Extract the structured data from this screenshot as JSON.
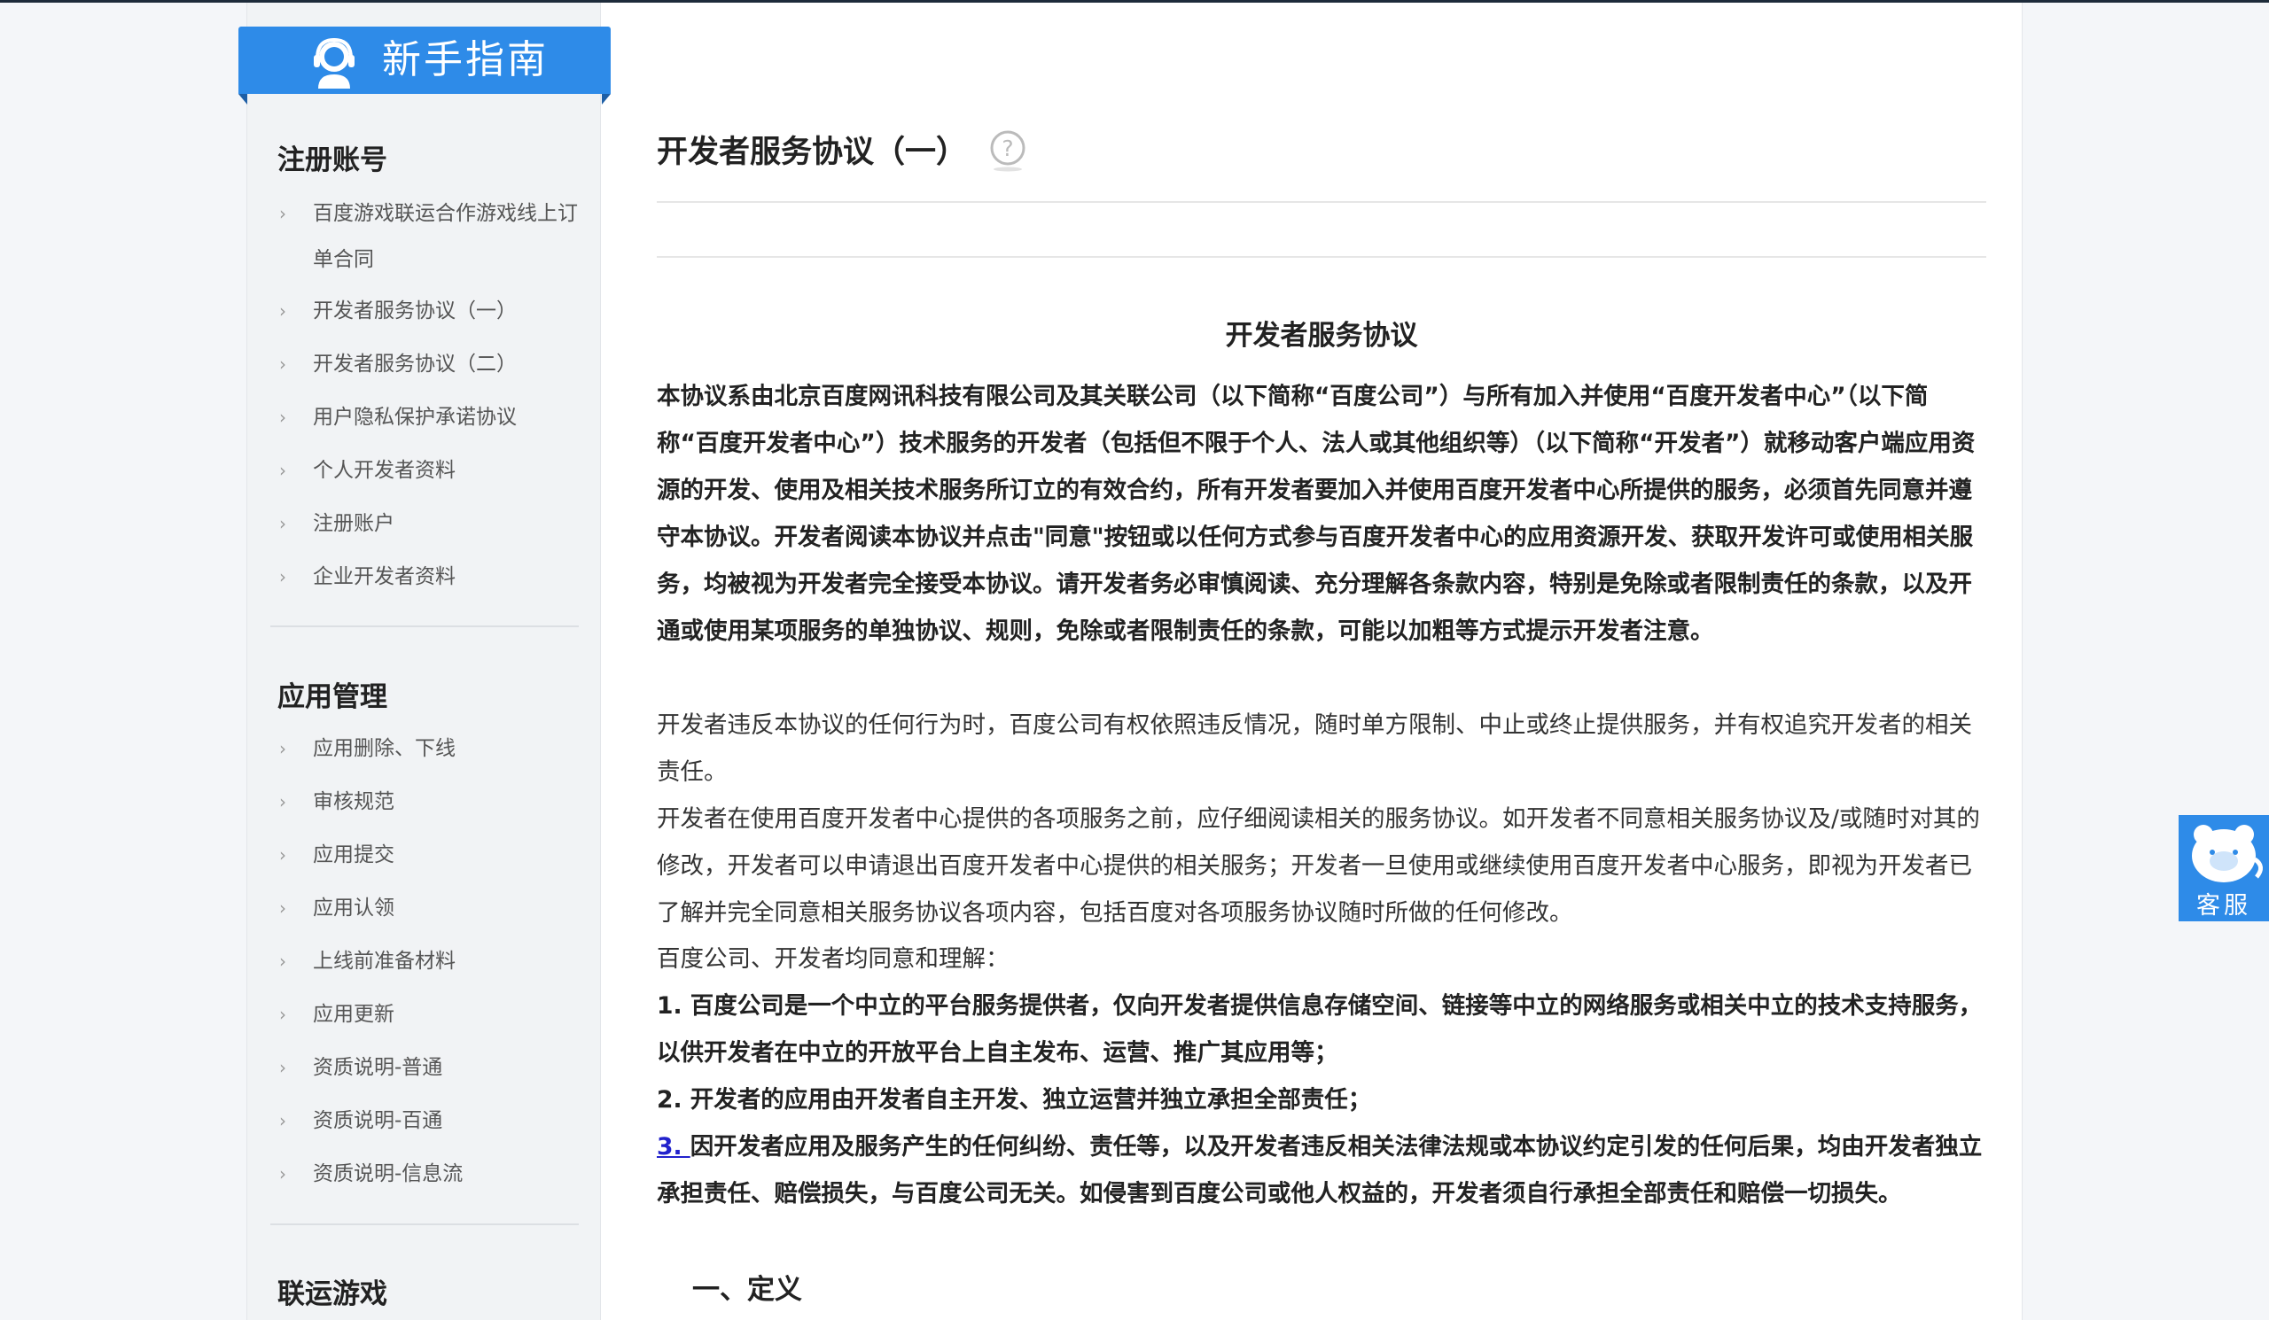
{
  "sidebar": {
    "banner_title": "新手指南",
    "sections": [
      {
        "heading": "注册账号",
        "items": [
          "百度游戏联运合作游戏线上订单合同",
          "开发者服务协议（一）",
          "开发者服务协议（二）",
          "用户隐私保护承诺协议",
          "个人开发者资料",
          "注册账户",
          "企业开发者资料"
        ]
      },
      {
        "heading": "应用管理",
        "items": [
          "应用删除、下线",
          "审核规范",
          "应用提交",
          "应用认领",
          "上线前准备材料",
          "应用更新",
          "资质说明-普通",
          "资质说明-百通",
          "资质说明-信息流"
        ]
      },
      {
        "heading": "联运游戏",
        "items": []
      }
    ]
  },
  "main": {
    "title": "开发者服务协议（一）",
    "doc_title": "开发者服务协议",
    "paragraphs": {
      "p1": "本协议系由北京百度网讯科技有限公司及其关联公司（以下简称“百度公司”）与所有加入并使用“百度开发者中心”（以下简称“百度开发者中心”）技术服务的开发者（包括但不限于个人、法人或其他组织等）（以下简称“开发者”）就移动客户端应用资源的开发、使用及相关技术服务所订立的有效合约，所有开发者要加入并使用百度开发者中心所提供的服务，必须首先同意并遵守本协议。开发者阅读本协议并点击\"同意\"按钮或以任何方式参与百度开发者中心的应用资源开发、获取开发许可或使用相关服务，均被视为开发者完全接受本协议。请开发者务必审慎阅读、充分理解各条款内容，特别是免除或者限制责任的条款，以及开通或使用某项服务的单独协议、规则，免除或者限制责任的条款，可能以加粗等方式提示开发者注意。",
      "p2": "开发者违反本协议的任何行为时，百度公司有权依照违反情况，随时单方限制、中止或终止提供服务，并有权追究开发者的相关责任。",
      "p3": "开发者在使用百度开发者中心提供的各项服务之前，应仔细阅读相关的服务协议。如开发者不同意相关服务协议及/或随时对其的修改，开发者可以申请退出百度开发者中心提供的相关服务；开发者一旦使用或继续使用百度开发者中心服务，即视为开发者已了解并完全同意相关服务协议各项内容，包括百度对各项服务协议随时所做的任何修改。",
      "p4": "百度公司、开发者均同意和理解：",
      "p5": "1. 百度公司是一个中立的平台服务提供者，仅向开发者提供信息存储空间、链接等中立的网络服务或相关中立的技术支持服务，以供开发者在中立的开放平台上自主发布、运营、推广其应用等；",
      "p6": "2. 开发者的应用由开发者自主开发、独立运营并独立承担全部责任；",
      "p7_num": "3. ",
      "p7": "因开发者应用及服务产生的任何纠纷、责任等，以及开发者违反相关法律法规或本协议约定引发的任何后果，均由开发者独立承担责任、赔偿损失，与百度公司无关。如侵害到百度公司或他人权益的，开发者须自行承担全部责任和赔偿一切损失。",
      "section1": "一、定义"
    }
  },
  "customer_service": {
    "label": "客服"
  },
  "colors": {
    "accent": "#2e8be8",
    "link": "#2222cc"
  },
  "icons": {
    "banner": "customer-support-icon",
    "help": "question-circle-icon",
    "nav": "chevron-right-icon",
    "cs": "bear-face-icon"
  }
}
